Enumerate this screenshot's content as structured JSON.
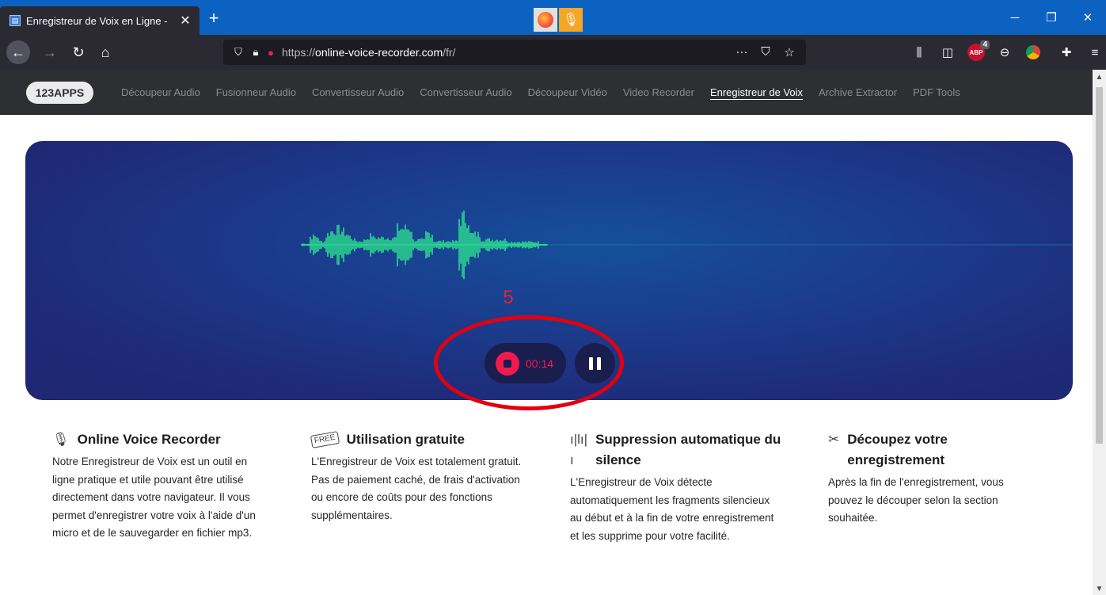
{
  "browser": {
    "tab_title": "Enregistreur de Voix en Ligne - ",
    "tab_close": "✕",
    "new_tab": "+",
    "url_prefix": "https://",
    "url_host": "online-voice-recorder.com",
    "url_path": "/fr/",
    "adblock_count": "4",
    "adblock_label": "ABP"
  },
  "site": {
    "logo": "123APPS",
    "nav": [
      {
        "label": "Découpeur Audio"
      },
      {
        "label": "Fusionneur Audio"
      },
      {
        "label": "Convertisseur Audio"
      },
      {
        "label": "Convertisseur Audio"
      },
      {
        "label": "Découpeur Vidéo"
      },
      {
        "label": "Video Recorder"
      },
      {
        "label": "Enregistreur de Voix"
      },
      {
        "label": "Archive Extractor"
      },
      {
        "label": "PDF Tools"
      }
    ],
    "active_index": 6
  },
  "recorder": {
    "annotation_number": "5",
    "timer": "00:14",
    "wave_color": "#2bd98f",
    "stop_color": "#f2194f"
  },
  "features": [
    {
      "icon": "microphone-icon",
      "title": "Online Voice Recorder",
      "text": "Notre Enregistreur de Voix est un outil en ligne pratique et utile pouvant être utilisé directement dans votre navigateur. Il vous permet d'enregistrer votre voix à l'aide d'un micro et de le sauvegarder en fichier mp3."
    },
    {
      "icon": "free-tag-icon",
      "title": "Utilisation gratuite",
      "text": "L'Enregistreur de Voix est totalement gratuit. Pas de paiement caché, de frais d'activation ou encore de coûts pour des fonctions supplémentaires."
    },
    {
      "icon": "waveform-icon",
      "title": "Suppression automatique du silence",
      "text": "L'Enregistreur de Voix détecte automatiquement les fragments silencieux au début et à la fin de votre enregistrement et les supprime pour votre facilité."
    },
    {
      "icon": "scissors-icon",
      "title": "Découpez votre enregistrement",
      "text": "Après la fin de l'enregistrement, vous pouvez le découper selon la section souhaitée."
    }
  ]
}
